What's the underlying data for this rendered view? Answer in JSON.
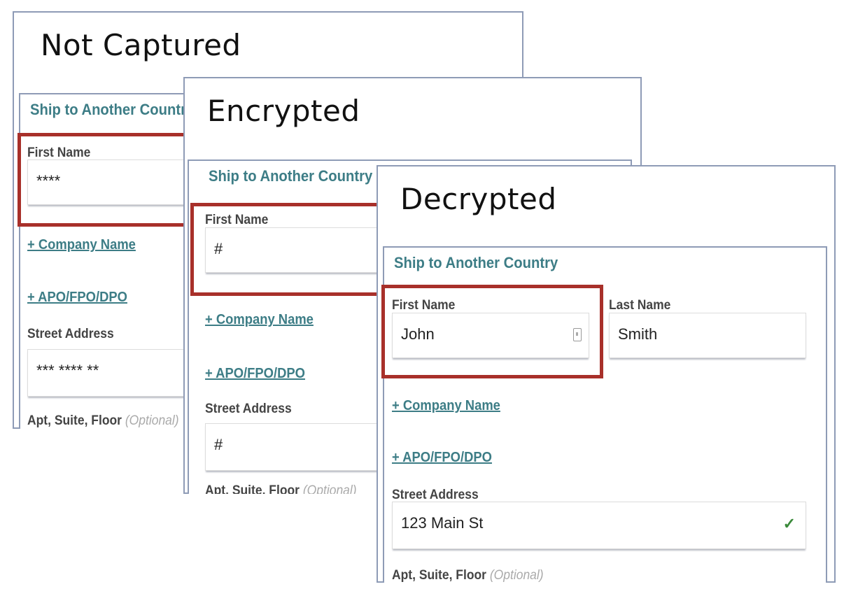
{
  "panels": [
    {
      "title": "Not Captured",
      "heading": "Ship to Another Country",
      "first_name_label": "First Name",
      "first_name_value": "****",
      "company_link": "+ Company Name",
      "apo_link": "+ APO/FPO/DPO",
      "street_label": "Street Address",
      "street_value": "*** **** **",
      "apt_label": "Apt, Suite, Floor",
      "apt_optional": "(Optional)"
    },
    {
      "title": "Encrypted",
      "heading": "Ship to Another Country",
      "first_name_label": "First Name",
      "first_name_value": "#",
      "company_link": "+ Company Name",
      "apo_link": "+ APO/FPO/DPO",
      "street_label": "Street Address",
      "street_value": "#",
      "apt_label": "Apt, Suite, Floor",
      "apt_optional": "(Optional)"
    },
    {
      "title": "Decrypted",
      "heading": "Ship to Another Country",
      "first_name_label": "First Name",
      "first_name_value": "John",
      "last_name_label": "Last Name",
      "last_name_value": "Smith",
      "company_link": "+ Company Name",
      "apo_link": "+ APO/FPO/DPO",
      "street_label": "Street Address",
      "street_value": "123 Main St",
      "apt_label": "Apt, Suite, Floor",
      "apt_optional": "(Optional)",
      "first_name_icon": "password-manager-icon",
      "street_icon": "checkmark-icon"
    }
  ],
  "colors": {
    "highlight": "#a8302a",
    "accent": "#3d7d86",
    "border": "#8e9bb6",
    "valid": "#3a8a3a"
  }
}
